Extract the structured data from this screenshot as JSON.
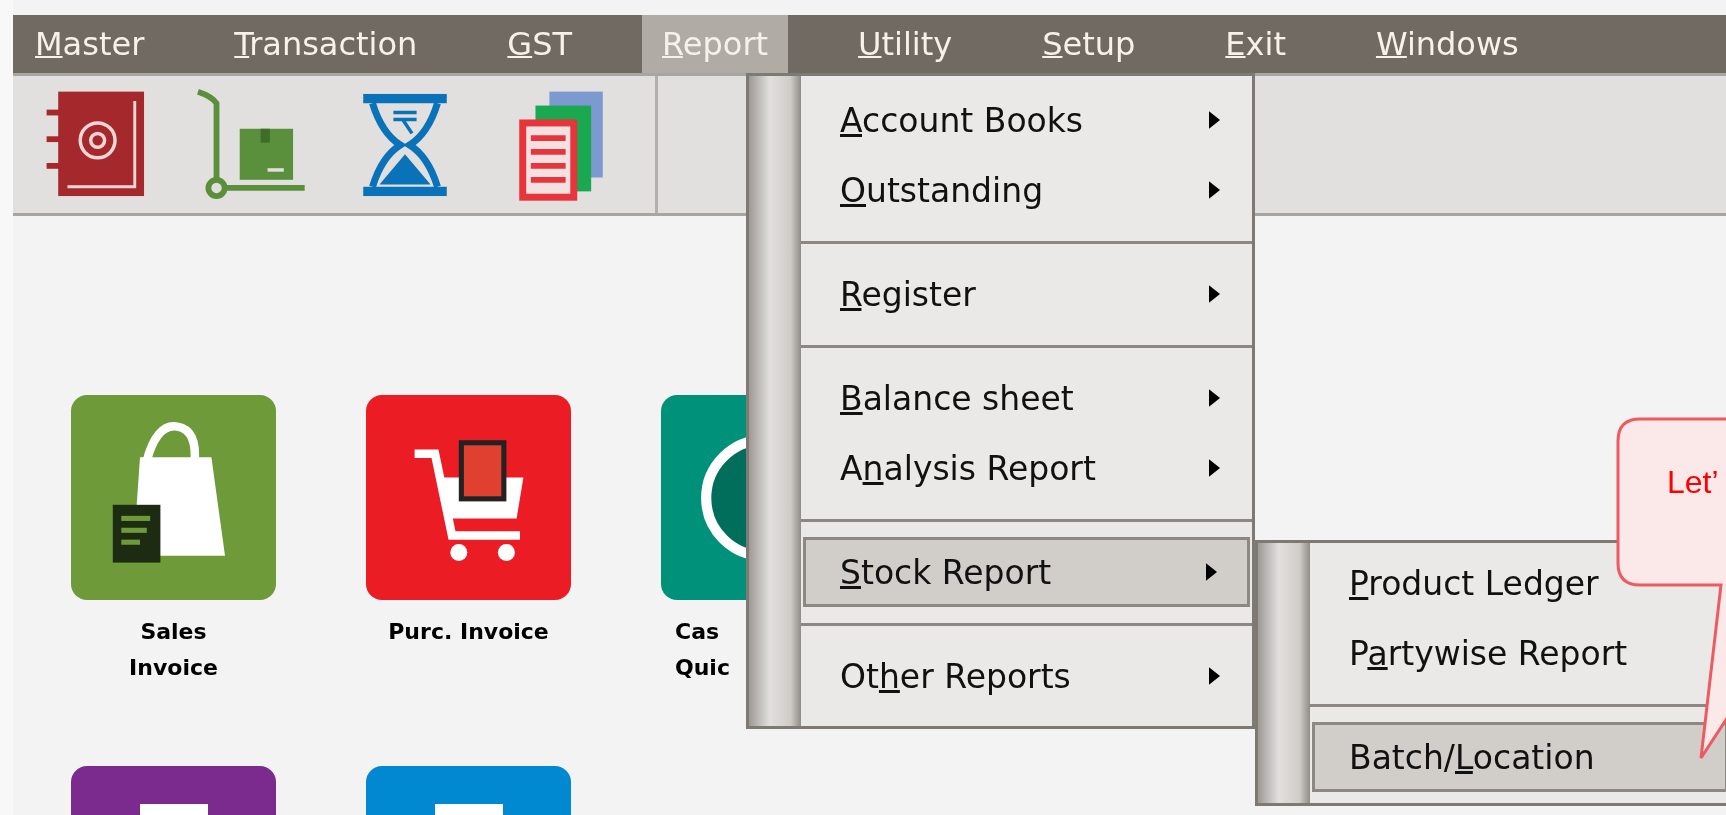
{
  "menu_bar": {
    "items": [
      {
        "key": "M",
        "post": "aster",
        "selected": false
      },
      {
        "key": "T",
        "post": "ransaction",
        "selected": false
      },
      {
        "key": "G",
        "post": "ST",
        "selected": false
      },
      {
        "key": "R",
        "post": "eport",
        "selected": true
      },
      {
        "key": "U",
        "post": "tility",
        "selected": false
      },
      {
        "key": "S",
        "post": "etup",
        "selected": false
      },
      {
        "key": "E",
        "post": "xit",
        "selected": false
      },
      {
        "key": "W",
        "post": "indows",
        "selected": false
      }
    ]
  },
  "report_menu": {
    "items": [
      {
        "kind": "item",
        "key": "A",
        "post": "ccount Books",
        "submenu": true,
        "selected": false
      },
      {
        "kind": "item",
        "key": "O",
        "post": "utstanding",
        "submenu": true,
        "selected": false
      },
      {
        "kind": "separator"
      },
      {
        "kind": "item",
        "key": "R",
        "post": "egister",
        "submenu": true,
        "selected": false
      },
      {
        "kind": "separator"
      },
      {
        "kind": "item",
        "key": "B",
        "post": "alance sheet",
        "submenu": true,
        "selected": false
      },
      {
        "kind": "item",
        "pre": "A",
        "key": "n",
        "post": "alysis Report",
        "submenu": true,
        "selected": false
      },
      {
        "kind": "separator"
      },
      {
        "kind": "item",
        "key": "S",
        "post": "tock Report",
        "submenu": true,
        "selected": true
      },
      {
        "kind": "separator"
      },
      {
        "kind": "item",
        "pre": "Ot",
        "key": "h",
        "post": "er Reports",
        "submenu": true,
        "selected": false
      }
    ]
  },
  "stock_submenu": {
    "items": [
      {
        "kind": "item",
        "key": "P",
        "post": "roduct Ledger",
        "submenu": false,
        "selected": false
      },
      {
        "kind": "item",
        "pre": "P",
        "key": "a",
        "post": "rtywise Report",
        "submenu": false,
        "selected": false
      },
      {
        "kind": "separator"
      },
      {
        "kind": "item",
        "pre": "Batch/",
        "key": "L",
        "post": "ocation",
        "submenu": false,
        "selected": true
      }
    ]
  },
  "tiles": [
    {
      "kind": "bag",
      "color": "#6f9a3a",
      "label_lines": [
        "Sales",
        "Invoice"
      ]
    },
    {
      "kind": "cart",
      "color": "#ec1c24",
      "label_lines": [
        "Purc. Invoice"
      ]
    },
    {
      "kind": "coin",
      "color": "#00917a",
      "covered": true,
      "label_lines": [
        "Cas",
        "Quic"
      ]
    },
    {
      "kind": "form",
      "color": "#7b2a8e"
    },
    {
      "kind": "doc",
      "color": "#0089d0"
    }
  ],
  "callout": {
    "text": "Let’"
  }
}
